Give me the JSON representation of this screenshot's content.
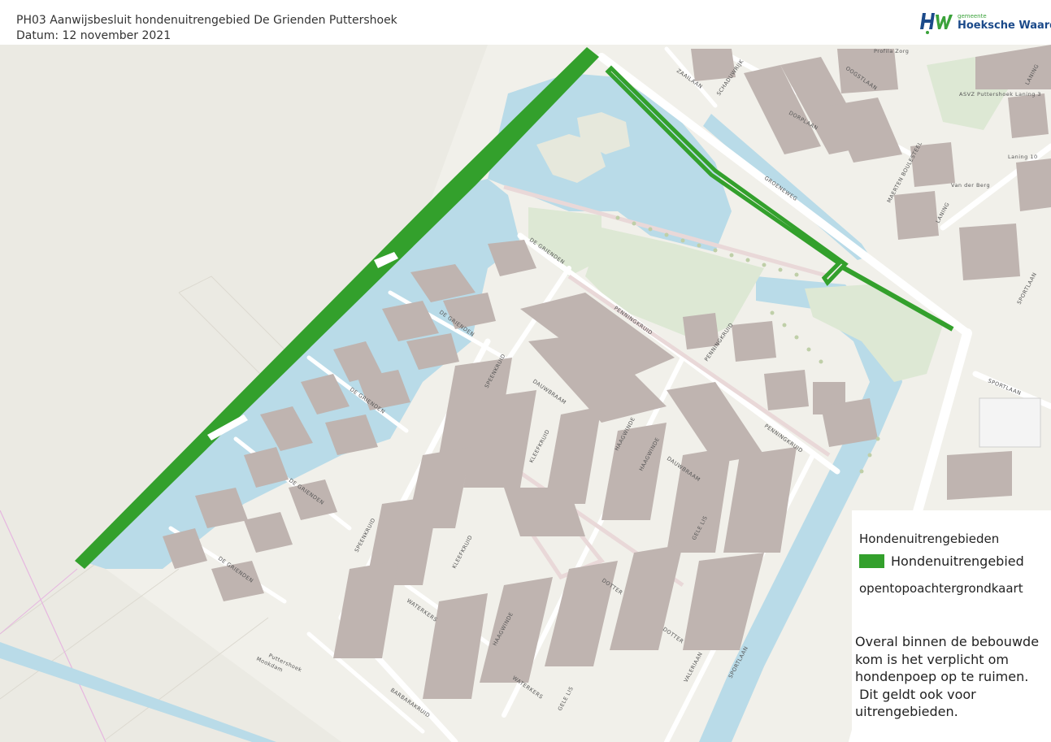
{
  "header": {
    "title": "PH03 Aanwijsbesluit hondenuitrengebied De Grienden Puttershoek",
    "date": "Datum: 12 november 2021"
  },
  "logo": {
    "mark": "HW",
    "small_text": "gemeente",
    "name": "Hoeksche Waard"
  },
  "legend": {
    "title": "Hondenuitrengebieden",
    "item_label": "Hondenuitrengebied",
    "item_color": "#33a02c",
    "basemap": "opentopoachtergrondkaart",
    "note_lines": [
      "Overal binnen de bebouwde",
      "kom is het verplicht om",
      "hondenpoep op te ruimen.",
      " Dit geldt ook voor",
      "uitrengebieden."
    ]
  },
  "map": {
    "colors": {
      "land": "#ecebe4",
      "water": "#b9dbe8",
      "green": "#dde8d4",
      "building": "#bfb4b0",
      "road": "#ffffff",
      "path": "#e9d8d8",
      "dog_area": "#33a02c"
    },
    "street_labels": [
      "DE GRIENDEN",
      "DE GRIENDEN",
      "DE GRIENDEN",
      "DE GRIENDEN",
      "DE GRIENDEN",
      "PENNINGKRUID",
      "PENNINGKRUID",
      "PENNINGKRUID",
      "SPEENKRUID",
      "SPEENKRUID",
      "DAUWBRAAM",
      "DAUWBRAAM",
      "KLEEFKRUID",
      "KLEEFKRUID",
      "HAAGWINDE",
      "HAAGWINDE",
      "HAAGWINDE",
      "GELE LIS",
      "GELE LIS",
      "WATERKERS",
      "WATERKERS",
      "DOTTER",
      "DOTTER",
      "VALERIAAN",
      "BARBARAKRUID",
      "GROENEWEG",
      "SPORTLAAN",
      "SPORTLAAN",
      "SPORTLAAN",
      "DORPLAAN",
      "OOGSTLAAN",
      "ZAAILAAN",
      "SCHADUWRIJK",
      "MAERTEN BOULESTEEL",
      "LANING",
      "LANING",
      "Puttershoek",
      "Mookdam"
    ],
    "poi_labels": [
      "Profila Zorg",
      "ASVZ Puttershoek Laning 3",
      "Laning 10",
      "Van der Berg"
    ]
  }
}
